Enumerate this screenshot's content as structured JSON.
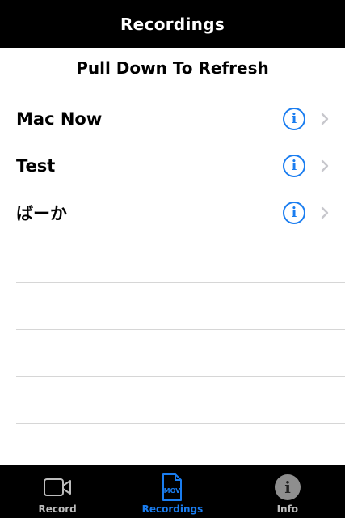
{
  "navbar": {
    "title": "Recordings"
  },
  "list": {
    "refresh_hint": "Pull Down To Refresh",
    "items": [
      {
        "label": "Mac Now"
      },
      {
        "label": "Test"
      },
      {
        "label": "ばーか"
      }
    ]
  },
  "tabbar": {
    "tabs": [
      {
        "label": "Record",
        "icon": "video-camera-icon",
        "active": false
      },
      {
        "label": "Recordings",
        "icon": "mov-file-icon",
        "icon_text": "MOV",
        "active": true
      },
      {
        "label": "Info",
        "icon": "info-circle-icon",
        "icon_text": "i",
        "active": false
      }
    ]
  },
  "colors": {
    "accent": "#1a7df0",
    "bar_background": "#000000",
    "inactive_tab": "#bdbdbd",
    "separator": "#d6d6d6"
  }
}
